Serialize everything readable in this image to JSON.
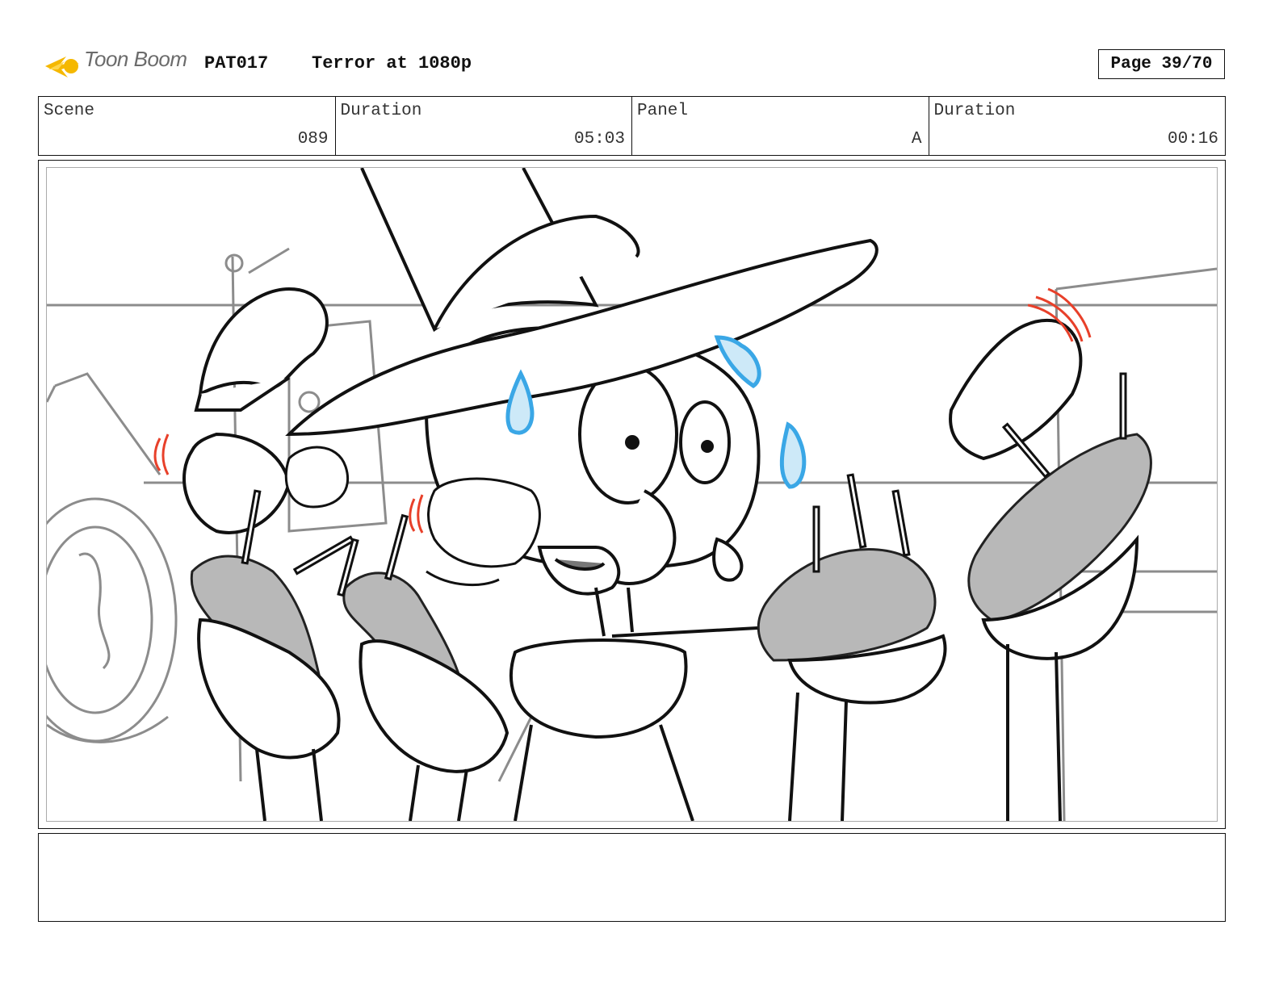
{
  "header": {
    "logo_text": "Toon Boom",
    "production_code": "PAT017",
    "episode_title": "Terror at 1080p",
    "page_label": "Page 39/70"
  },
  "info": {
    "scene_label": "Scene",
    "scene_value": "089",
    "scene_duration_label": "Duration",
    "scene_duration_value": "05:03",
    "panel_label": "Panel",
    "panel_value": "A",
    "panel_duration_label": "Duration",
    "panel_duration_value": "00:16"
  },
  "panel_image": {
    "icon": "storyboard-sketch-image"
  },
  "notes": {
    "text": ""
  },
  "colors": {
    "logo_flare": "#f5b800",
    "sweat_drops": "#3aa7e6",
    "shake_lines": "#e8402a",
    "sketch_gray": "#8c8c8c",
    "shading_gray": "#b8b8b8"
  }
}
